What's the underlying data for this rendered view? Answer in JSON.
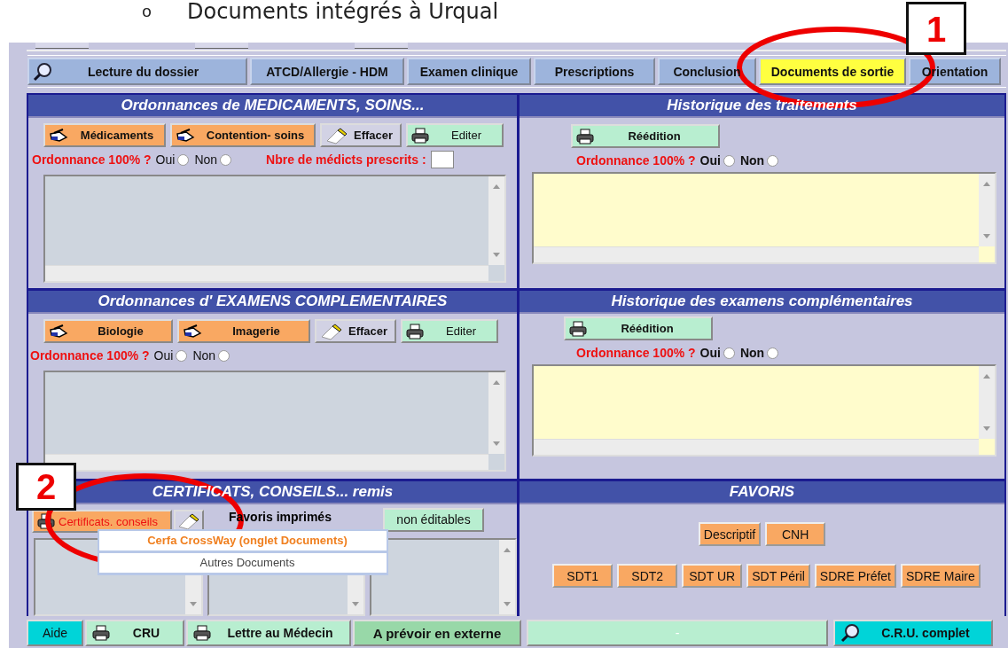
{
  "heading": {
    "bullet": "o",
    "text": "Documents intégrés à Urqual"
  },
  "tabs": [
    {
      "label": "Lecture du dossier",
      "kind": "search",
      "selected": false
    },
    {
      "label": "ATCD/Allergie - HDM",
      "kind": "plain",
      "selected": false
    },
    {
      "label": "Examen clinique",
      "kind": "plain",
      "selected": false
    },
    {
      "label": "Prescriptions",
      "kind": "plain",
      "selected": false
    },
    {
      "label": "Conclusion",
      "kind": "plain",
      "selected": false
    },
    {
      "label": "Documents de sortie",
      "kind": "plain",
      "selected": true
    },
    {
      "label": "Orientation",
      "kind": "plain",
      "selected": false
    }
  ],
  "panels": [
    {
      "kind": "prescription",
      "title": "Ordonnances de  MEDICAMENTS, SOINS...",
      "buttons": [
        {
          "label": "Médicaments",
          "kind": "order"
        },
        {
          "label": "Contention-  soins",
          "kind": "order"
        },
        {
          "label": "Effacer",
          "kind": "erase"
        },
        {
          "label": "Editer",
          "kind": "print"
        }
      ],
      "question": {
        "label": "Ordonnance 100% ?",
        "options": [
          {
            "label": "Oui",
            "selected": false
          },
          {
            "label": "Non",
            "selected": false
          }
        ]
      },
      "count_field": {
        "label": "Nbre de médicts prescrits :"
      }
    },
    {
      "kind": "history",
      "title": "Historique des traitements",
      "button": {
        "label": "Réédition"
      },
      "question": {
        "label": "Ordonnance 100% ?",
        "options": [
          {
            "label": "Oui",
            "selected": false
          },
          {
            "label": "Non",
            "selected": false
          }
        ]
      }
    },
    {
      "kind": "prescription",
      "title": "Ordonnances d' EXAMENS COMPLEMENTAIRES",
      "buttons": [
        {
          "label": "Biologie",
          "kind": "order"
        },
        {
          "label": "Imagerie",
          "kind": "order"
        },
        {
          "label": "Effacer",
          "kind": "erase"
        },
        {
          "label": "Editer",
          "kind": "print"
        }
      ],
      "question": {
        "label": "Ordonnance 100% ?",
        "options": [
          {
            "label": "Oui",
            "selected": false
          },
          {
            "label": "Non",
            "selected": false
          }
        ]
      }
    },
    {
      "kind": "history",
      "title": "Historique des examens complémentaires",
      "button": {
        "label": "Réédition"
      },
      "question": {
        "label": "Ordonnance 100% ?",
        "options": [
          {
            "label": "Oui",
            "selected": false
          },
          {
            "label": "Non",
            "selected": false
          }
        ]
      }
    },
    {
      "kind": "certificates",
      "title": "CERTIFICATS,  CONSEILS...  remis",
      "cert_button": {
        "label": "Certificats. conseils"
      },
      "favorites_label": "Favoris imprimés",
      "non_editable_button": {
        "label": "non éditables"
      },
      "menu": [
        {
          "label": "Cerfa CrossWay (onglet Documents)",
          "selected": true
        },
        {
          "label": "Autres Documents",
          "selected": false
        }
      ]
    },
    {
      "kind": "favorites",
      "title": "FAVORIS",
      "button_groups": [
        {
          "buttons": [
            {
              "label": "Descriptif"
            },
            {
              "label": "CNH"
            }
          ]
        },
        {
          "buttons": [
            {
              "label": "SDT1"
            },
            {
              "label": "SDT2"
            },
            {
              "label": "SDT UR"
            },
            {
              "label": "SDT Péril"
            },
            {
              "label": "SDRE Préfet"
            },
            {
              "label": "SDRE Maire"
            }
          ]
        }
      ]
    }
  ],
  "bottom_bar": [
    {
      "label": "Aide",
      "kind": "help"
    },
    {
      "label": "CRU",
      "kind": "print"
    },
    {
      "label": "Lettre au Médecin",
      "kind": "print"
    },
    {
      "label": "A prévoir en externe",
      "kind": "external"
    },
    {
      "label": "-",
      "kind": "status"
    },
    {
      "label": "C.R.U. complet",
      "kind": "search"
    }
  ],
  "callouts": [
    {
      "number": "1"
    },
    {
      "number": "2"
    }
  ]
}
